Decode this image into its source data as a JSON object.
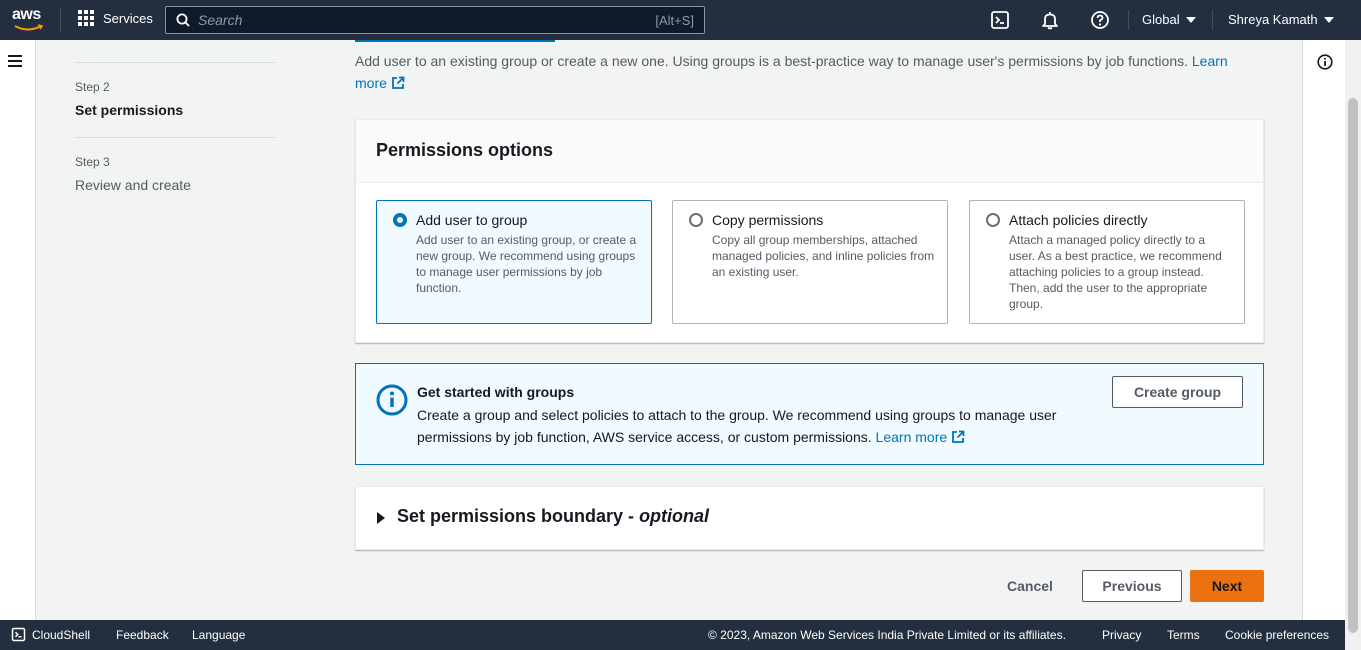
{
  "topnav": {
    "logo_text": "aws",
    "services_label": "Services",
    "search_placeholder": "Search",
    "search_shortcut": "[Alt+S]",
    "region_label": "Global",
    "user_label": "Shreya Kamath",
    "icons": [
      "cloudshell-icon",
      "notifications-icon",
      "help-icon"
    ]
  },
  "steps": [
    {
      "label": "Step 2",
      "title": "Set permissions",
      "state": "active"
    },
    {
      "label": "Step 3",
      "title": "Review and create",
      "state": "inactive"
    }
  ],
  "main": {
    "description": "Add user to an existing group or create a new one. Using groups is a best-practice way to manage user's permissions by job functions.",
    "description_link": "Learn more",
    "panel_title": "Permissions options",
    "options": [
      {
        "title": "Add user to group",
        "desc": "Add user to an existing group, or create a new group. We recommend using groups to manage user permissions by job function.",
        "selected": true
      },
      {
        "title": "Copy permissions",
        "desc": "Copy all group memberships, attached managed policies, and inline policies from an existing user.",
        "selected": false
      },
      {
        "title": "Attach policies directly",
        "desc": "Attach a managed policy directly to a user. As a best practice, we recommend attaching policies to a group instead. Then, add the user to the appropriate group.",
        "selected": false
      }
    ],
    "info": {
      "title": "Get started with groups",
      "text": "Create a group and select policies to attach to the group. We recommend using groups to manage user permissions by job function, AWS service access, or custom permissions.",
      "link": "Learn more",
      "button": "Create group"
    },
    "boundary": {
      "title": "Set permissions boundary - ",
      "optional": "optional"
    },
    "actions": {
      "cancel": "Cancel",
      "previous": "Previous",
      "next": "Next"
    }
  },
  "footer": {
    "cloudshell": "CloudShell",
    "feedback": "Feedback",
    "language": "Language",
    "copyright": "© 2023, Amazon Web Services India Private Limited or its affiliates.",
    "privacy": "Privacy",
    "terms": "Terms",
    "cookies": "Cookie preferences"
  },
  "colors": {
    "nav_bg": "#232f3e",
    "link": "#0073bb",
    "primary": "#ec7211",
    "selected_bg": "#f1faff"
  }
}
